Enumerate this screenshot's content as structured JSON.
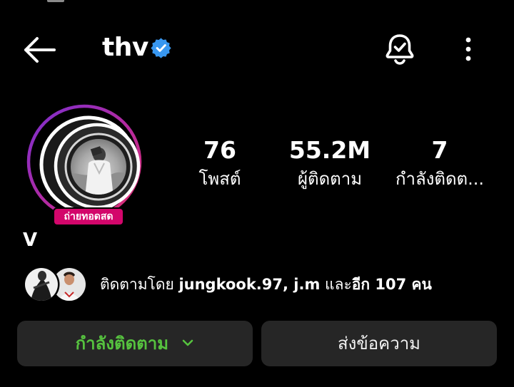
{
  "header": {
    "username": "thv",
    "verified": true
  },
  "profile": {
    "live_badge": "ถ่ายทอดสด",
    "display_name": "V"
  },
  "stats": {
    "posts": {
      "value": "76",
      "label": "โพสต์"
    },
    "followers": {
      "value": "55.2M",
      "label": "ผู้ติดตาม"
    },
    "following": {
      "value": "7",
      "label": "กำลังติดต..."
    }
  },
  "followed_by": {
    "prefix": "ติดตามโดย ",
    "names": "jungkook.97, j.m",
    "connector": " และ",
    "others": "อีก 107 คน"
  },
  "actions": {
    "following_label": "กำลังติดตาม",
    "message_label": "ส่งข้อความ"
  },
  "icons": {
    "back": "arrow-left-icon",
    "verified": "verified-badge-icon",
    "notifications": "bell-check-icon",
    "more": "more-vertical-icon",
    "dropdown": "chevron-down-icon"
  },
  "colors": {
    "background": "#000000",
    "verified_blue": "#3897f0",
    "live_pink": "#d3066b",
    "ring_start": "#8a2be2",
    "ring_end": "#e1306c",
    "following_green": "#56c23f",
    "button_bg": "#262626"
  }
}
